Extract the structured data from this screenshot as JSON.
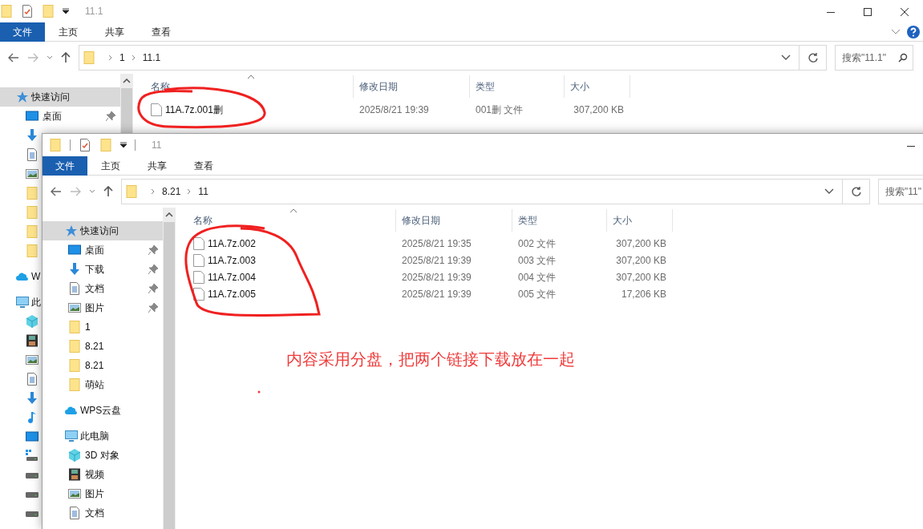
{
  "windows": [
    {
      "title": "11.1",
      "ribbon_tabs": [
        {
          "label": "文件",
          "selected": true
        },
        {
          "label": "主页",
          "selected": false
        },
        {
          "label": "共享",
          "selected": false
        },
        {
          "label": "查看",
          "selected": false
        }
      ],
      "breadcrumb": [
        "1",
        "11.1"
      ],
      "search": {
        "placeholder": "搜索\"11.1\""
      },
      "sidebar": [
        {
          "kind": "star",
          "label": "快速访问",
          "selected": true,
          "children": [
            {
              "kind": "desktop",
              "label": "桌面",
              "pinned": true
            },
            {
              "kind": "download"
            },
            {
              "kind": "document"
            },
            {
              "kind": "picture"
            },
            {
              "kind": "folder"
            },
            {
              "kind": "folder"
            },
            {
              "kind": "folder"
            },
            {
              "kind": "folder"
            }
          ]
        },
        {
          "kind": "cloud",
          "label": "W",
          "selected": false
        },
        {
          "kind": "computer",
          "label": "此",
          "selected": false,
          "children": [
            {
              "kind": "cube"
            },
            {
              "kind": "video"
            },
            {
              "kind": "picture"
            },
            {
              "kind": "document"
            },
            {
              "kind": "download"
            },
            {
              "kind": "music"
            },
            {
              "kind": "desktop"
            },
            {
              "kind": "drive-win"
            },
            {
              "kind": "drive"
            },
            {
              "kind": "drive"
            },
            {
              "kind": "drive"
            }
          ]
        }
      ],
      "columns": [
        "名称",
        "修改日期",
        "类型",
        "大小"
      ],
      "rows": [
        {
          "name": "11A.7z.001删",
          "date": "2025/8/21 19:39",
          "type": "001删 文件",
          "size": "307,200 KB"
        }
      ]
    },
    {
      "title": "11",
      "ribbon_tabs": [
        {
          "label": "文件",
          "selected": true
        },
        {
          "label": "主页",
          "selected": false
        },
        {
          "label": "共享",
          "selected": false
        },
        {
          "label": "查看",
          "selected": false
        }
      ],
      "breadcrumb": [
        "8.21",
        "11"
      ],
      "search": {
        "placeholder": "搜索\"11\""
      },
      "sidebar": [
        {
          "kind": "star",
          "label": "快速访问",
          "selected": true,
          "children": [
            {
              "kind": "desktop",
              "label": "桌面",
              "pinned": true
            },
            {
              "kind": "download",
              "label": "下载",
              "pinned": true
            },
            {
              "kind": "document",
              "label": "文档",
              "pinned": true
            },
            {
              "kind": "picture",
              "label": "图片",
              "pinned": true
            },
            {
              "kind": "folder",
              "label": "1",
              "pinned": false
            },
            {
              "kind": "folder",
              "label": "8.21",
              "pinned": false
            },
            {
              "kind": "folder",
              "label": "8.21",
              "pinned": false
            },
            {
              "kind": "folder",
              "label": "萌站",
              "pinned": false
            }
          ]
        },
        {
          "kind": "cloud",
          "label": "WPS云盘",
          "selected": false
        },
        {
          "kind": "computer",
          "label": "此电脑",
          "selected": false,
          "children": [
            {
              "kind": "cube",
              "label": "3D 对象"
            },
            {
              "kind": "video",
              "label": "视频"
            },
            {
              "kind": "picture",
              "label": "图片"
            },
            {
              "kind": "document",
              "label": "文档"
            }
          ]
        }
      ],
      "columns": [
        "名称",
        "修改日期",
        "类型",
        "大小"
      ],
      "rows": [
        {
          "name": "11A.7z.002",
          "date": "2025/8/21 19:35",
          "type": "002 文件",
          "size": "307,200 KB"
        },
        {
          "name": "11A.7z.003",
          "date": "2025/8/21 19:39",
          "type": "003 文件",
          "size": "307,200 KB"
        },
        {
          "name": "11A.7z.004",
          "date": "2025/8/21 19:39",
          "type": "004 文件",
          "size": "307,200 KB"
        },
        {
          "name": "11A.7z.005",
          "date": "2025/8/21 19:39",
          "type": "005 文件",
          "size": "17,206 KB"
        }
      ]
    }
  ],
  "annotation": {
    "note": "内容采用分盘，把两个链接下载放在一起"
  }
}
